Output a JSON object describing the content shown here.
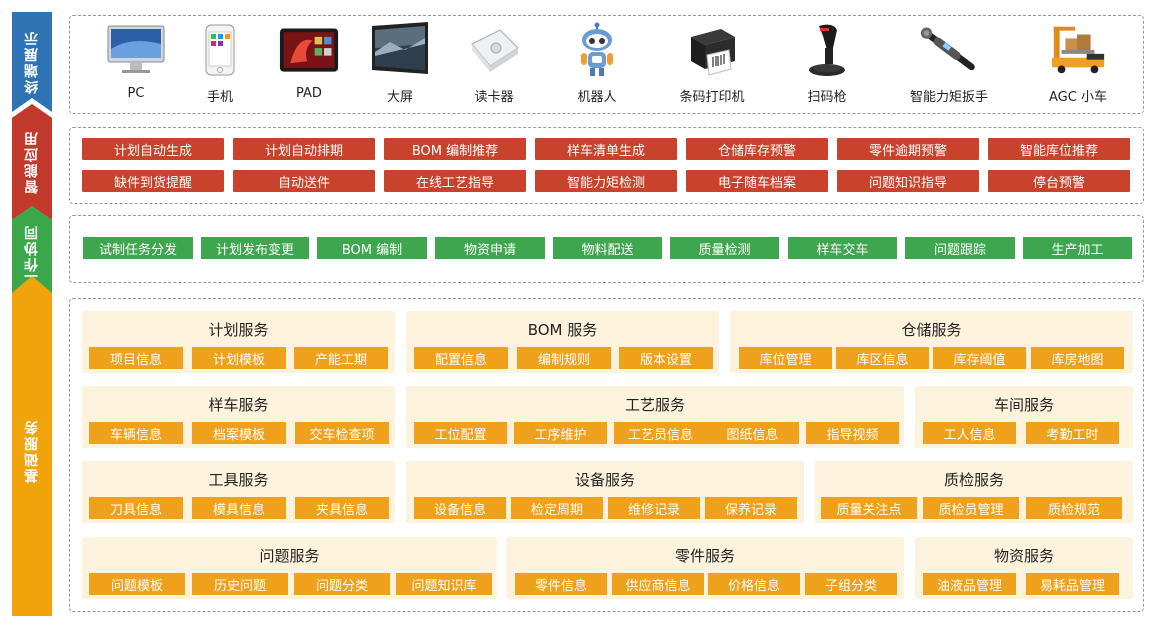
{
  "layers": {
    "terminal": "终端展示",
    "smart_app": "智能应用",
    "workflow": "工作协同",
    "base": "基础服务"
  },
  "devices": [
    {
      "label": "PC",
      "icon": "pc-icon"
    },
    {
      "label": "手机",
      "icon": "phone-icon"
    },
    {
      "label": "PAD",
      "icon": "tablet-icon"
    },
    {
      "label": "大屏",
      "icon": "large-screen-icon"
    },
    {
      "label": "读卡器",
      "icon": "card-reader-icon"
    },
    {
      "label": "机器人",
      "icon": "robot-icon"
    },
    {
      "label": "条码打印机",
      "icon": "barcode-printer-icon"
    },
    {
      "label": "扫码枪",
      "icon": "scanner-gun-icon"
    },
    {
      "label": "智能力矩扳手",
      "icon": "torque-wrench-icon"
    },
    {
      "label": "AGC 小车",
      "icon": "agc-cart-icon"
    }
  ],
  "smart_apps": {
    "row1": [
      "计划自动生成",
      "计划自动排期",
      "BOM 编制推荐",
      "样车清单生成",
      "仓储库存预警",
      "零件逾期预警",
      "智能库位推荐"
    ],
    "row2": [
      "缺件到货提醒",
      "自动送件",
      "在线工艺指导",
      "智能力矩检测",
      "电子随车档案",
      "问题知识指导",
      "停台预警"
    ]
  },
  "workflow": [
    "试制任务分发",
    "计划发布变更",
    "BOM 编制",
    "物资申请",
    "物料配送",
    "质量检测",
    "样车交车",
    "问题跟踪",
    "生产加工"
  ],
  "services": {
    "plan": {
      "title": "计划服务",
      "items": [
        "项目信息",
        "计划模板",
        "产能工期"
      ]
    },
    "bom": {
      "title": "BOM 服务",
      "items": [
        "配置信息",
        "编制规则",
        "版本设置"
      ]
    },
    "storage": {
      "title": "仓储服务",
      "items": [
        "库位管理",
        "库区信息",
        "库存阈值",
        "库房地图"
      ]
    },
    "sample": {
      "title": "样车服务",
      "items": [
        "车辆信息",
        "档案模板",
        "交车检查项"
      ]
    },
    "process": {
      "title": "工艺服务",
      "items": [
        "工位配置",
        "工序维护",
        "工艺员信息",
        "图纸信息",
        "指导视频"
      ]
    },
    "workshop": {
      "title": "车间服务",
      "items": [
        "工人信息",
        "考勤工时"
      ]
    },
    "tool": {
      "title": "工具服务",
      "items": [
        "刀具信息",
        "模具信息",
        "夹具信息"
      ]
    },
    "equipment": {
      "title": "设备服务",
      "items": [
        "设备信息",
        "检定周期",
        "维修记录",
        "保养记录"
      ]
    },
    "qc": {
      "title": "质检服务",
      "items": [
        "质量关注点",
        "质检员管理",
        "质检规范"
      ]
    },
    "issue": {
      "title": "问题服务",
      "items": [
        "问题模板",
        "历史问题",
        "问题分类",
        "问题知识库"
      ]
    },
    "part": {
      "title": "零件服务",
      "items": [
        "零件信息",
        "供应商信息",
        "价格信息",
        "子组分类"
      ]
    },
    "material": {
      "title": "物资服务",
      "items": [
        "油液品管理",
        "易耗品管理"
      ]
    }
  },
  "colors": {
    "terminal": "#2e74b5",
    "smart_app": "#c9432c",
    "workflow": "#3ea64f",
    "base": "#f0a11c",
    "group_bg": "#fdf3dc"
  }
}
